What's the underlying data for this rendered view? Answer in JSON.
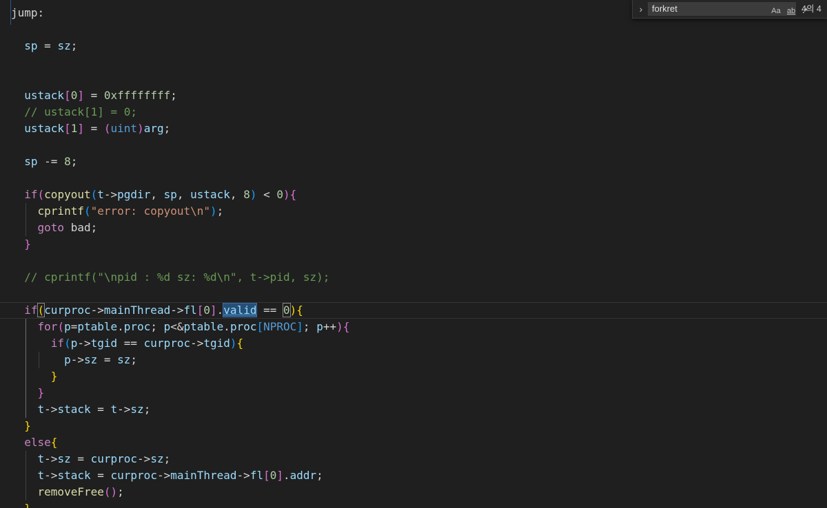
{
  "find_widget": {
    "toggle_icon": "chevron-right-icon",
    "query": "forkret",
    "match_case_label": "Aa",
    "match_word_label": "ab",
    "regex_label": ".*",
    "match_count": "4의 4"
  },
  "code_lines": [
    [
      [
        "lbl",
        "jump:"
      ]
    ],
    [],
    [
      [
        "v",
        "  sp"
      ],
      [
        "o",
        " = "
      ],
      [
        "v",
        "sz"
      ],
      [
        "p",
        ";"
      ]
    ],
    [],
    [],
    [
      [
        "v",
        "  ustack"
      ],
      [
        "b2",
        "["
      ],
      [
        "n",
        "0"
      ],
      [
        "b2",
        "]"
      ],
      [
        "o",
        " = "
      ],
      [
        "n",
        "0xffffffff"
      ],
      [
        "p",
        ";"
      ]
    ],
    [
      [
        "c",
        "  // ustack[1] = 0;"
      ]
    ],
    [
      [
        "v",
        "  ustack"
      ],
      [
        "b2",
        "["
      ],
      [
        "n",
        "1"
      ],
      [
        "b2",
        "]"
      ],
      [
        "o",
        " = "
      ],
      [
        "b2",
        "("
      ],
      [
        "t",
        "uint"
      ],
      [
        "b2",
        ")"
      ],
      [
        "v",
        "arg"
      ],
      [
        "p",
        ";"
      ]
    ],
    [],
    [
      [
        "v",
        "  sp"
      ],
      [
        "o",
        " -= "
      ],
      [
        "n",
        "8"
      ],
      [
        "p",
        ";"
      ]
    ],
    [],
    [
      [
        "k",
        "  if"
      ],
      [
        "b2",
        "("
      ],
      [
        "f",
        "copyout"
      ],
      [
        "b3",
        "("
      ],
      [
        "v",
        "t"
      ],
      [
        "o",
        "->"
      ],
      [
        "v",
        "pgdir"
      ],
      [
        "p",
        ", "
      ],
      [
        "v",
        "sp"
      ],
      [
        "p",
        ", "
      ],
      [
        "v",
        "ustack"
      ],
      [
        "p",
        ", "
      ],
      [
        "n",
        "8"
      ],
      [
        "b3",
        ")"
      ],
      [
        "o",
        " < "
      ],
      [
        "n",
        "0"
      ],
      [
        "b2",
        ")"
      ],
      [
        "b2",
        "{"
      ]
    ],
    [
      [
        "f",
        "    cprintf"
      ],
      [
        "b3",
        "("
      ],
      [
        "s",
        "\"error: copyout\\n\""
      ],
      [
        "b3",
        ")"
      ],
      [
        "p",
        ";"
      ]
    ],
    [
      [
        "k",
        "    goto"
      ],
      [
        "lbl",
        " bad"
      ],
      [
        "p",
        ";"
      ]
    ],
    [
      [
        "b2",
        "  }"
      ]
    ],
    [],
    [
      [
        "c",
        "  // cprintf(\"\\npid : %d sz: %d\\n\", t->pid, sz);"
      ]
    ],
    [],
    [
      [
        "k",
        "  if"
      ],
      [
        "b1",
        "("
      ],
      [
        "v",
        "curproc"
      ],
      [
        "o",
        "->"
      ],
      [
        "v",
        "mainThread"
      ],
      [
        "o",
        "->"
      ],
      [
        "v",
        "fl"
      ],
      [
        "b2",
        "["
      ],
      [
        "n",
        "0"
      ],
      [
        "b2",
        "]"
      ],
      [
        "p",
        "."
      ],
      [
        "v",
        "valid"
      ],
      [
        "o",
        " == "
      ],
      [
        "n",
        "0"
      ],
      [
        "b1",
        ")"
      ],
      [
        "b1",
        "{"
      ]
    ],
    [
      [
        "k",
        "    for"
      ],
      [
        "b2",
        "("
      ],
      [
        "v",
        "p"
      ],
      [
        "o",
        "="
      ],
      [
        "v",
        "ptable"
      ],
      [
        "p",
        "."
      ],
      [
        "v",
        "proc"
      ],
      [
        "p",
        "; "
      ],
      [
        "v",
        "p"
      ],
      [
        "o",
        "<&"
      ],
      [
        "v",
        "ptable"
      ],
      [
        "p",
        "."
      ],
      [
        "v",
        "proc"
      ],
      [
        "b3",
        "["
      ],
      [
        "t",
        "NPROC"
      ],
      [
        "b3",
        "]"
      ],
      [
        "p",
        "; "
      ],
      [
        "v",
        "p"
      ],
      [
        "o",
        "++"
      ],
      [
        "b2",
        ")"
      ],
      [
        "b2",
        "{"
      ]
    ],
    [
      [
        "k",
        "      if"
      ],
      [
        "b3",
        "("
      ],
      [
        "v",
        "p"
      ],
      [
        "o",
        "->"
      ],
      [
        "v",
        "tgid"
      ],
      [
        "o",
        " == "
      ],
      [
        "v",
        "curproc"
      ],
      [
        "o",
        "->"
      ],
      [
        "v",
        "tgid"
      ],
      [
        "b3",
        ")"
      ],
      [
        "b1",
        "{"
      ]
    ],
    [
      [
        "v",
        "        p"
      ],
      [
        "o",
        "->"
      ],
      [
        "v",
        "sz"
      ],
      [
        "o",
        " = "
      ],
      [
        "v",
        "sz"
      ],
      [
        "p",
        ";"
      ]
    ],
    [
      [
        "b1",
        "      }"
      ]
    ],
    [
      [
        "b2",
        "    }"
      ]
    ],
    [
      [
        "v",
        "    t"
      ],
      [
        "o",
        "->"
      ],
      [
        "v",
        "stack"
      ],
      [
        "o",
        " = "
      ],
      [
        "v",
        "t"
      ],
      [
        "o",
        "->"
      ],
      [
        "v",
        "sz"
      ],
      [
        "p",
        ";"
      ]
    ],
    [
      [
        "b1",
        "  }"
      ]
    ],
    [
      [
        "k",
        "  else"
      ],
      [
        "b1",
        "{"
      ]
    ],
    [
      [
        "v",
        "    t"
      ],
      [
        "o",
        "->"
      ],
      [
        "v",
        "sz"
      ],
      [
        "o",
        " = "
      ],
      [
        "v",
        "curproc"
      ],
      [
        "o",
        "->"
      ],
      [
        "v",
        "sz"
      ],
      [
        "p",
        ";"
      ]
    ],
    [
      [
        "v",
        "    t"
      ],
      [
        "o",
        "->"
      ],
      [
        "v",
        "stack"
      ],
      [
        "o",
        " = "
      ],
      [
        "v",
        "curproc"
      ],
      [
        "o",
        "->"
      ],
      [
        "v",
        "mainThread"
      ],
      [
        "o",
        "->"
      ],
      [
        "v",
        "fl"
      ],
      [
        "b2",
        "["
      ],
      [
        "n",
        "0"
      ],
      [
        "b2",
        "]"
      ],
      [
        "p",
        "."
      ],
      [
        "v",
        "addr"
      ],
      [
        "p",
        ";"
      ]
    ],
    [
      [
        "f",
        "    removeFree"
      ],
      [
        "b2",
        "()"
      ],
      [
        "p",
        ";"
      ]
    ],
    [
      [
        "b1",
        "  }"
      ]
    ]
  ]
}
